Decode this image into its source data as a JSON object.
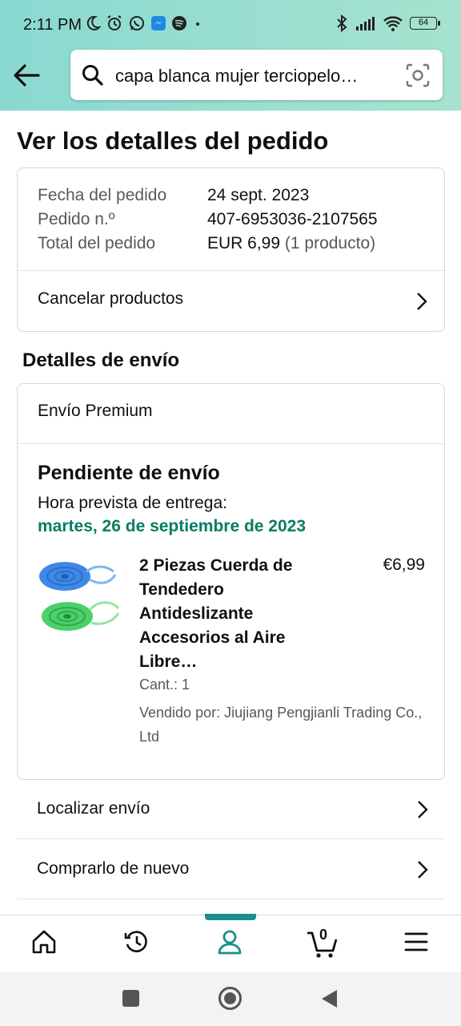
{
  "status_bar": {
    "time": "2:11 PM",
    "battery": "64",
    "icons": [
      "moon-icon",
      "alarm-icon",
      "whatsapp-icon",
      "messenger-icon",
      "spotify-icon",
      "dot-icon",
      "bluetooth-icon",
      "signal-icon",
      "wifi-icon",
      "battery-icon"
    ]
  },
  "header": {
    "search_text": "capa blanca mujer terciopelo…",
    "icons": [
      "back-arrow-icon",
      "search-icon",
      "camera-scan-icon"
    ]
  },
  "page": {
    "title": "Ver los detalles del pedido"
  },
  "order_summary": {
    "date_label": "Fecha del pedido",
    "date_value": "24 sept. 2023",
    "number_label": "Pedido n.º",
    "number_value": "407-6953036-2107565",
    "total_label": "Total del pedido",
    "total_value": "EUR 6,99",
    "total_count": "(1 producto)",
    "cancel_label": "Cancelar productos"
  },
  "shipping": {
    "section_title": "Detalles de envío",
    "method": "Envío Premium",
    "status": "Pendiente de envío",
    "eta_label": "Hora prevista de entrega:",
    "eta_date": "martes, 26 de septiembre de 2023",
    "product": {
      "name": "2 Piezas Cuerda de Tendedero Antideslizante Accesorios al Aire Libre…",
      "price": "€6,99",
      "qty": "Cant.: 1",
      "seller": "Vendido por: Jiujiang Pengjianli Trading Co., Ltd"
    }
  },
  "actions": {
    "track": "Localizar envío",
    "buy_again": "Comprarlo de nuevo"
  },
  "bottom_nav": {
    "items": [
      "home-icon",
      "history-icon",
      "account-icon",
      "cart-icon",
      "menu-icon"
    ],
    "active": "account-icon",
    "cart_count": "0",
    "accent": "#1a8f8d"
  },
  "colors": {
    "header_gradient_start": "#89d9d1",
    "header_gradient_end": "#a6e3cf",
    "delivery_green": "#067d62"
  }
}
